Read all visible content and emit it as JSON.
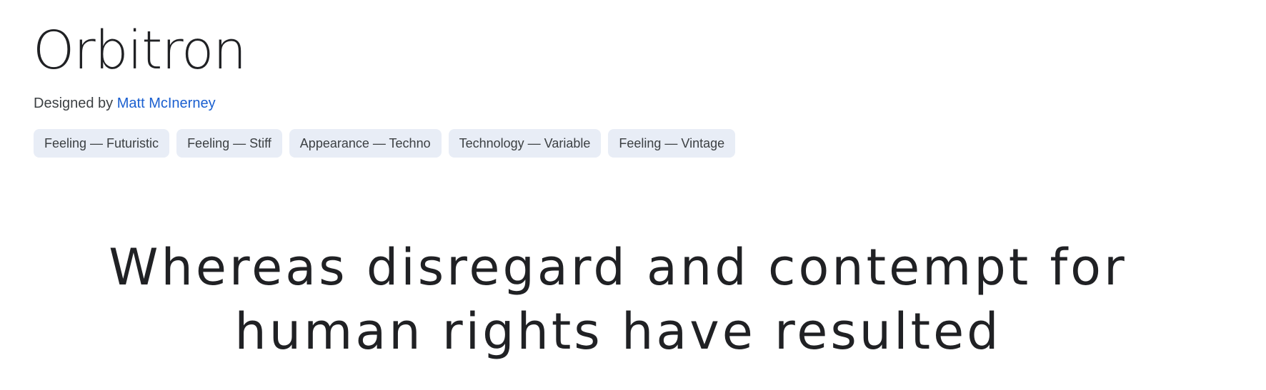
{
  "font": {
    "name": "Orbitron",
    "designed_by_prefix": "Designed by ",
    "designer": "Matt McInerney"
  },
  "tags": [
    {
      "label": "Feeling — Futuristic"
    },
    {
      "label": "Feeling — Stiff"
    },
    {
      "label": "Appearance — Techno"
    },
    {
      "label": "Technology — Variable"
    },
    {
      "label": "Feeling — Vintage"
    }
  ],
  "preview": {
    "line1": "Whereas disregard and contempt for",
    "line2": "human rights have resulted"
  },
  "colors": {
    "link": "#1a5fd0",
    "tag_bg": "#e8edf6",
    "text": "#202124"
  }
}
